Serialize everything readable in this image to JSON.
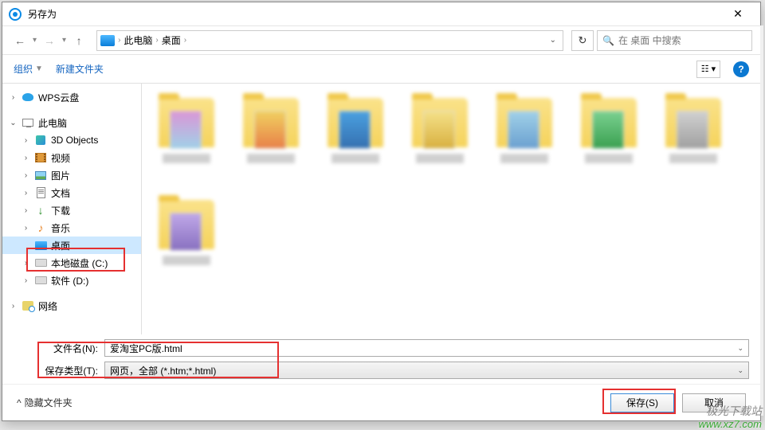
{
  "title": "另存为",
  "nav": {
    "back": "←",
    "forward": "→",
    "up": "↑"
  },
  "breadcrumb": {
    "root": "此电脑",
    "current": "桌面"
  },
  "search": {
    "placeholder": "在 桌面 中搜索"
  },
  "toolbar": {
    "organize": "组织",
    "newfolder": "新建文件夹"
  },
  "tree": {
    "wps": "WPS云盘",
    "thispc": "此电脑",
    "obj3d": "3D Objects",
    "videos": "视频",
    "pictures": "图片",
    "documents": "文档",
    "downloads": "下载",
    "music": "音乐",
    "desktop": "桌面",
    "drive_c": "本地磁盘 (C:)",
    "drive_d": "软件 (D:)",
    "network": "网络"
  },
  "fields": {
    "name_label": "文件名(N):",
    "name_value": "爱淘宝PC版.html",
    "type_label": "保存类型(T):",
    "type_value": "网页，全部 (*.htm;*.html)"
  },
  "footer": {
    "hide_folders": "隐藏文件夹",
    "save": "保存(S)",
    "cancel": "取消"
  },
  "watermark": {
    "site": "极光下载站",
    "url": "www.xz7.com"
  }
}
